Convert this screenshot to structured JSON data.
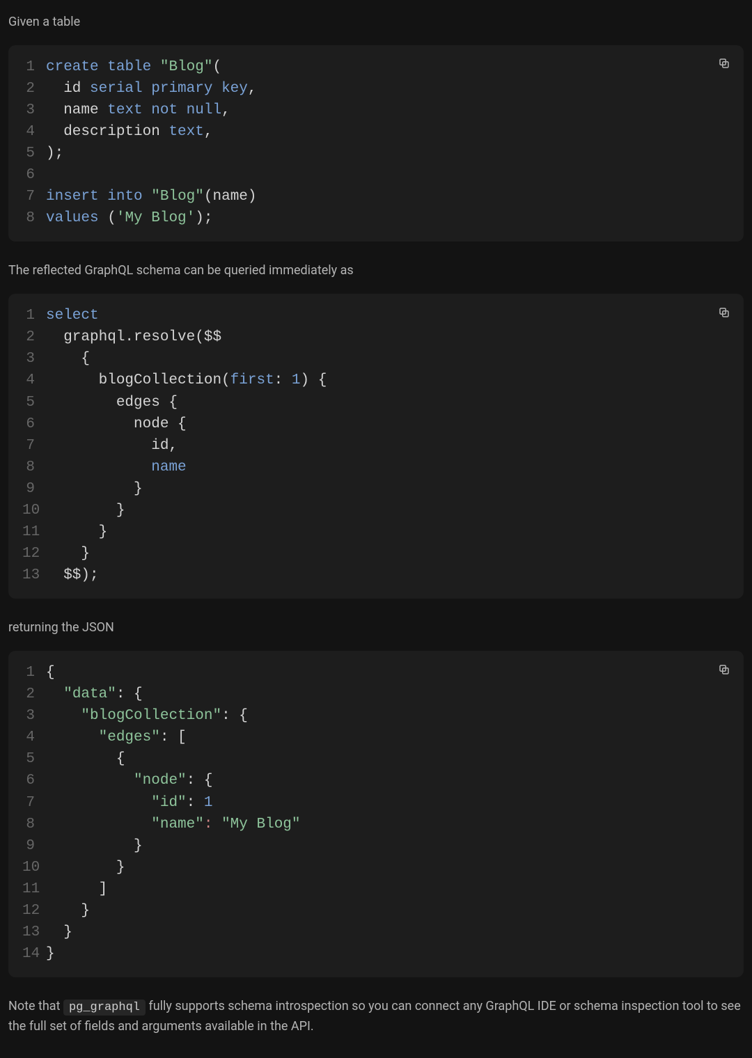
{
  "paragraphs": {
    "p1": "Given a table",
    "p2": "The reflected GraphQL schema can be queried immediately as",
    "p3": "returning the JSON",
    "p4_pre": "Note that ",
    "p4_code": "pg_graphql",
    "p4_post": " fully supports schema introspection so you can connect any GraphQL IDE or schema inspection tool to see the full set of fields and arguments available in the API."
  },
  "icons": {
    "copy": "copy"
  },
  "code_block_1": {
    "lines": [
      [
        {
          "t": "create",
          "c": "tok-kw"
        },
        {
          "t": " ",
          "c": "tok-default"
        },
        {
          "t": "table",
          "c": "tok-kw"
        },
        {
          "t": " ",
          "c": "tok-default"
        },
        {
          "t": "\"Blog\"",
          "c": "tok-str"
        },
        {
          "t": "(",
          "c": "tok-punc"
        }
      ],
      [
        {
          "t": "  id ",
          "c": "tok-default"
        },
        {
          "t": "serial",
          "c": "tok-kw"
        },
        {
          "t": " ",
          "c": "tok-default"
        },
        {
          "t": "primary",
          "c": "tok-kw"
        },
        {
          "t": " ",
          "c": "tok-default"
        },
        {
          "t": "key",
          "c": "tok-kw"
        },
        {
          "t": ",",
          "c": "tok-punc"
        }
      ],
      [
        {
          "t": "  name ",
          "c": "tok-default"
        },
        {
          "t": "text",
          "c": "tok-kw"
        },
        {
          "t": " ",
          "c": "tok-default"
        },
        {
          "t": "not",
          "c": "tok-kw"
        },
        {
          "t": " ",
          "c": "tok-default"
        },
        {
          "t": "null",
          "c": "tok-kw"
        },
        {
          "t": ",",
          "c": "tok-punc"
        }
      ],
      [
        {
          "t": "  description ",
          "c": "tok-default"
        },
        {
          "t": "text",
          "c": "tok-kw"
        },
        {
          "t": ",",
          "c": "tok-punc"
        }
      ],
      [
        {
          "t": ");",
          "c": "tok-punc"
        }
      ],
      [
        {
          "t": "",
          "c": "tok-default"
        }
      ],
      [
        {
          "t": "insert",
          "c": "tok-kw"
        },
        {
          "t": " ",
          "c": "tok-default"
        },
        {
          "t": "into",
          "c": "tok-kw"
        },
        {
          "t": " ",
          "c": "tok-default"
        },
        {
          "t": "\"Blog\"",
          "c": "tok-str"
        },
        {
          "t": "(name)",
          "c": "tok-punc"
        }
      ],
      [
        {
          "t": "values",
          "c": "tok-kw"
        },
        {
          "t": " (",
          "c": "tok-punc"
        },
        {
          "t": "'My Blog'",
          "c": "tok-str"
        },
        {
          "t": ");",
          "c": "tok-punc"
        }
      ]
    ]
  },
  "code_block_2": {
    "lines": [
      [
        {
          "t": "select",
          "c": "tok-kw"
        }
      ],
      [
        {
          "t": "  graphql.resolve($$",
          "c": "tok-default"
        }
      ],
      [
        {
          "t": "    {",
          "c": "tok-default"
        }
      ],
      [
        {
          "t": "      blogCollection(",
          "c": "tok-default"
        },
        {
          "t": "first",
          "c": "tok-kw"
        },
        {
          "t": ": ",
          "c": "tok-punc"
        },
        {
          "t": "1",
          "c": "tok-num"
        },
        {
          "t": ") {",
          "c": "tok-default"
        }
      ],
      [
        {
          "t": "        edges {",
          "c": "tok-default"
        }
      ],
      [
        {
          "t": "          node {",
          "c": "tok-default"
        }
      ],
      [
        {
          "t": "            id,",
          "c": "tok-default"
        }
      ],
      [
        {
          "t": "            ",
          "c": "tok-default"
        },
        {
          "t": "name",
          "c": "tok-kw"
        }
      ],
      [
        {
          "t": "          }",
          "c": "tok-default"
        }
      ],
      [
        {
          "t": "        }",
          "c": "tok-default"
        }
      ],
      [
        {
          "t": "      }",
          "c": "tok-default"
        }
      ],
      [
        {
          "t": "    }",
          "c": "tok-default"
        }
      ],
      [
        {
          "t": "  $$);",
          "c": "tok-default"
        }
      ]
    ]
  },
  "code_block_3": {
    "lines": [
      [
        {
          "t": "{",
          "c": "tok-punc"
        }
      ],
      [
        {
          "t": "  ",
          "c": "tok-default"
        },
        {
          "t": "\"data\"",
          "c": "tok-str"
        },
        {
          "t": ": {",
          "c": "tok-punc"
        }
      ],
      [
        {
          "t": "    ",
          "c": "tok-default"
        },
        {
          "t": "\"blogCollection\"",
          "c": "tok-str"
        },
        {
          "t": ": {",
          "c": "tok-punc"
        }
      ],
      [
        {
          "t": "      ",
          "c": "tok-default"
        },
        {
          "t": "\"edges\"",
          "c": "tok-str"
        },
        {
          "t": ": [",
          "c": "tok-punc"
        }
      ],
      [
        {
          "t": "        {",
          "c": "tok-punc"
        }
      ],
      [
        {
          "t": "          ",
          "c": "tok-default"
        },
        {
          "t": "\"node\"",
          "c": "tok-str"
        },
        {
          "t": ": {",
          "c": "tok-punc"
        }
      ],
      [
        {
          "t": "            ",
          "c": "tok-default"
        },
        {
          "t": "\"id\"",
          "c": "tok-str"
        },
        {
          "t": ": ",
          "c": "tok-punc"
        },
        {
          "t": "1",
          "c": "tok-num"
        }
      ],
      [
        {
          "t": "            ",
          "c": "tok-default"
        },
        {
          "t": "\"name\"",
          "c": "tok-str"
        },
        {
          "t": ":",
          "c": "tok-red"
        },
        {
          "t": " ",
          "c": "tok-default"
        },
        {
          "t": "\"My Blog\"",
          "c": "tok-str"
        }
      ],
      [
        {
          "t": "          }",
          "c": "tok-punc"
        }
      ],
      [
        {
          "t": "        }",
          "c": "tok-punc"
        }
      ],
      [
        {
          "t": "      ]",
          "c": "tok-punc"
        }
      ],
      [
        {
          "t": "    }",
          "c": "tok-punc"
        }
      ],
      [
        {
          "t": "  }",
          "c": "tok-punc"
        }
      ],
      [
        {
          "t": "}",
          "c": "tok-punc"
        }
      ]
    ]
  }
}
